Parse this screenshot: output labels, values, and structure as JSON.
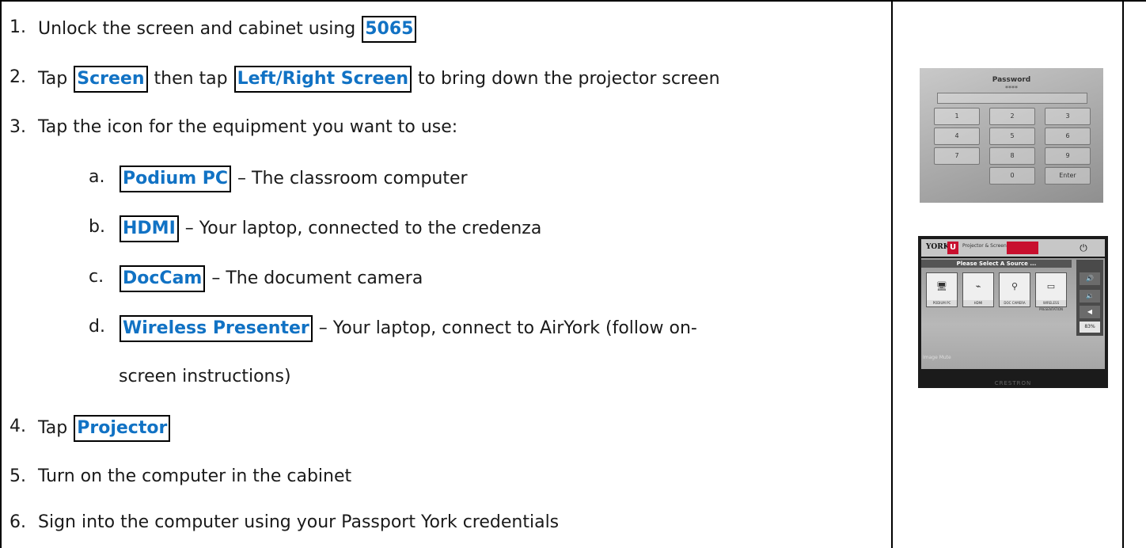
{
  "steps": [
    {
      "num": "1.",
      "pre": "Unlock the screen and cabinet using ",
      "kw1": "5065"
    },
    {
      "num": "2.",
      "pre": "Tap ",
      "kw1": "Screen",
      "mid": " then tap ",
      "kw2": "Left/Right Screen",
      "post": " to bring down the projector screen"
    },
    {
      "num": "3.",
      "text": "Tap the icon for the equipment you want to use:"
    },
    {
      "num": "a.",
      "kw1": "Podium PC",
      "post": " – The classroom computer"
    },
    {
      "num": "b.",
      "kw1": "HDMI",
      "post": " – Your laptop, connected to the credenza"
    },
    {
      "num": "c.",
      "kw1": "DocCam",
      "post": " – The document camera"
    },
    {
      "num": "d.",
      "kw1": "Wireless Presenter",
      "post": " – Your laptop, connect to AirYork (follow on-",
      "cont": "screen instructions)"
    },
    {
      "num": "4.",
      "pre": "Tap ",
      "kw1": "Projector"
    },
    {
      "num": "5.",
      "text": "Turn on the computer in the cabinet"
    },
    {
      "num": "6.",
      "text": "Sign into the computer using your Passport York credentials"
    }
  ],
  "keypad_image": {
    "label": "Password",
    "mask": "****",
    "keys": [
      "1",
      "2",
      "3",
      "4",
      "5",
      "6",
      "7",
      "8",
      "9",
      "0",
      "Enter"
    ]
  },
  "panel_image": {
    "logo": "YORK",
    "logo_u": "U",
    "projector_tab": "Projector & Screens",
    "select_title": "Please Select A Source ...",
    "sources": [
      "PODIUM PC",
      "HDMI",
      "DOC CAMERA",
      "WIRELESS PRESENTATION"
    ],
    "volume_pct": "83%",
    "mute_label": "Image Mute",
    "brand": "CRESTRON"
  }
}
